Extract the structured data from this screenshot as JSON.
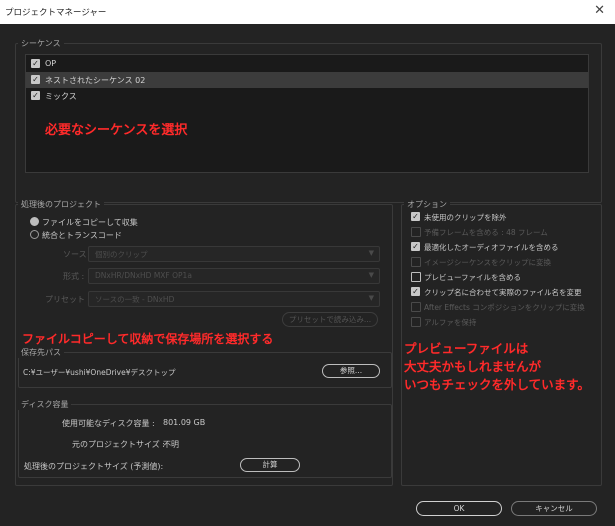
{
  "window": {
    "title": "プロジェクトマネージャー",
    "close_glyph": "✕"
  },
  "sequences": {
    "legend": "シーケンス",
    "items": [
      {
        "label": "OP",
        "checked": true,
        "selected": false
      },
      {
        "label": "ネストされたシーケンス 02",
        "checked": true,
        "selected": true
      },
      {
        "label": "ミックス",
        "checked": true,
        "selected": false
      }
    ]
  },
  "annotations": {
    "select_sequence": "必要なシーケンスを選択",
    "copy_note": "ファイルコピーして収納で保存場所を選択する",
    "preview_line1": "プレビューファイルは",
    "preview_line2": "大丈夫かもしれませんが",
    "preview_line3": "いつもチェックを外しています。"
  },
  "processing": {
    "legend": "処理後のプロジェクト",
    "radio_copy": "ファイルをコピーして収集",
    "radio_consolidate": "統合とトランスコード",
    "source_label": "ソース :",
    "source_value": "個別のクリップ",
    "format_label": "形式 :",
    "format_value": "DNxHR/DNxHD MXF OP1a",
    "preset_label": "プリセット :",
    "preset_value": "ソースの一致 - DNxHD",
    "import_preset_button": "プリセットで読み込み..."
  },
  "destination": {
    "legend": "保存先パス",
    "path": "C:¥ユーザー¥ushi¥OneDrive¥デスクトップ",
    "browse_button": "参照..."
  },
  "disk": {
    "legend": "ディスク容量",
    "available_label": "使用可能なディスク容量 :",
    "available_value": "801.09 GB",
    "original_label": "元のプロジェクトサイズ :",
    "original_value": "不明",
    "result_label": "処理後のプロジェクトサイズ (予測値):",
    "calc_button": "計算"
  },
  "options": {
    "legend": "オプション",
    "items": [
      {
        "label": "未使用のクリップを除外",
        "checked": true,
        "enabled": true
      },
      {
        "label": "予備フレームを含める : 48 フレーム",
        "checked": false,
        "enabled": false
      },
      {
        "label": "最適化したオーディオファイルを含める",
        "checked": true,
        "enabled": true
      },
      {
        "label": "イメージシーケンスをクリップに変換",
        "checked": false,
        "enabled": false
      },
      {
        "label": "プレビューファイルを含める",
        "checked": false,
        "enabled": true
      },
      {
        "label": "クリップ名に合わせて実際のファイル名を変更",
        "checked": true,
        "enabled": true
      },
      {
        "label": "After Effects コンポジションをクリップに変換",
        "checked": false,
        "enabled": false
      },
      {
        "label": "アルファを保持",
        "checked": false,
        "enabled": false
      }
    ]
  },
  "footer": {
    "ok_button": "OK",
    "cancel_button": "キャンセル"
  },
  "colors": {
    "background": "#232323",
    "annotation_red": "#ff2a2a",
    "titlebar": "#ffffff"
  }
}
